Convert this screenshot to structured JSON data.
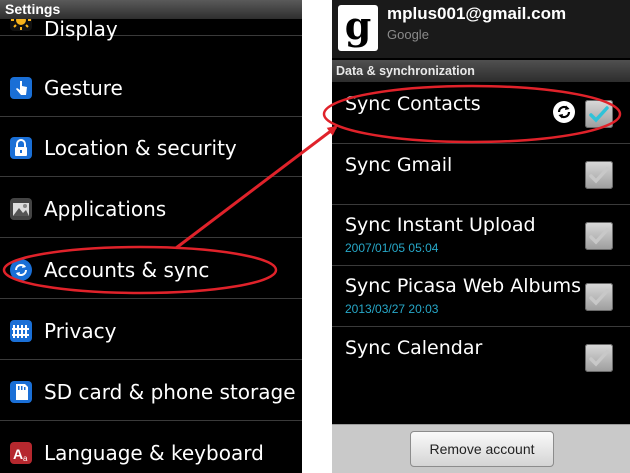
{
  "left": {
    "title": "Settings",
    "items": [
      {
        "label": "Display",
        "icon": "display-icon"
      },
      {
        "label": "Gesture",
        "icon": "gesture-icon"
      },
      {
        "label": "Location & security",
        "icon": "lock-icon"
      },
      {
        "label": "Applications",
        "icon": "applications-icon"
      },
      {
        "label": "Accounts & sync",
        "icon": "sync-icon"
      },
      {
        "label": "Privacy",
        "icon": "privacy-icon"
      },
      {
        "label": "SD card & phone storage",
        "icon": "sdcard-icon"
      },
      {
        "label": "Language & keyboard",
        "icon": "language-icon"
      }
    ]
  },
  "right": {
    "account": {
      "email": "mplus001@gmail.com",
      "provider": "Google",
      "logo_letter": "g"
    },
    "section": "Data & synchronization",
    "items": [
      {
        "label": "Sync Contacts",
        "date": "",
        "checked": true,
        "syncing": true
      },
      {
        "label": "Sync Gmail",
        "date": "",
        "checked": true,
        "syncing": false
      },
      {
        "label": "Sync Instant Upload",
        "date": "2007/01/05 05:04",
        "checked": true,
        "syncing": false
      },
      {
        "label": "Sync Picasa Web Albums",
        "date": "2013/03/27 20:03",
        "checked": true,
        "syncing": false
      },
      {
        "label": "Sync Calendar",
        "date": "",
        "checked": true,
        "syncing": false
      }
    ],
    "remove_button": "Remove account"
  },
  "colors": {
    "highlight": "#e0222a",
    "arrow": "#e0222a",
    "date_text": "#27a8c8",
    "check_active": "#2fc2d8"
  }
}
